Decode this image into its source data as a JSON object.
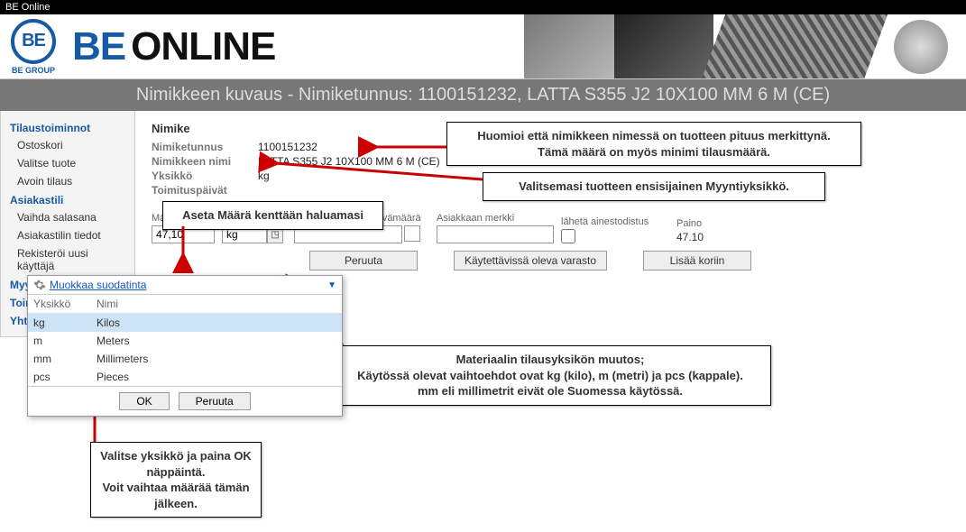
{
  "titlebar": "BE Online",
  "brand": {
    "logo_text": "BE",
    "logo_sub": "BE GROUP",
    "title1": "BE",
    "title2": "ONLINE"
  },
  "subheader": "Nimikkeen kuvaus - Nimiketunnus: 1100151232, LATTA S355 J2 10X100 MM 6 M (CE)",
  "sidebar": {
    "h1": "Tilaustoiminnot",
    "g1": [
      "Ostoskori",
      "Valitse tuote",
      "Avoin tilaus"
    ],
    "h2": "Asiakastili",
    "g2": [
      "Vaihda salasana",
      "Asiakastilin tiedot",
      "Rekisteröi uusi käyttäjä"
    ],
    "h3": "Myyntiehdot",
    "h4": "Toim",
    "h5": "Yhtey"
  },
  "item": {
    "section": "Nimike",
    "l_code": "Nimiketunnus",
    "v_code": "1100151232",
    "l_name": "Nimikkeen nimi",
    "v_name": "LATTA S355 J2 10X100 MM 6 M (CE)",
    "l_unit": "Yksikkö",
    "v_unit": "kg",
    "l_days": "Toimituspäivät"
  },
  "form": {
    "l_qty": "Määrä",
    "v_qty": "47,10",
    "l_unit": "Yksikkö",
    "v_unit": "kg",
    "l_reqdate": "Pyydetty toimituspäivämäärä",
    "v_reqdate": "",
    "l_cmark": "Asiakkaan merkki",
    "v_cmark": "",
    "l_cert": "lähetä ainestodistus",
    "l_weight": "Paino",
    "v_weight": "47.10"
  },
  "buttons": {
    "cancel": "Peruuta",
    "stock": "Käytettävissä oleva varasto",
    "add": "Lisää koriin"
  },
  "callouts": {
    "c1": "Huomioi että nimikkeen nimessä on tuotteen pituus merkittynä.\nTämä määrä on myös minimi tilausmäärä.",
    "c2": "Valitsemasi tuotteen ensisijainen Myyntiyksikkö.",
    "c3": "Aseta Määrä kenttään haluamasi",
    "c4": "Materiaalin tilausyksikön muutos;\nKäytössä olevat vaihtoehdot ovat kg (kilo), m (metri) ja pcs (kappale).\nmm eli millimetrit eivät ole Suomessa käytössä.",
    "c5": "Valitse yksikkö ja paina OK näppäintä.\nVoit vaihtaa määrää tämän jälkeen."
  },
  "dropdown": {
    "edit": "Muokkaa suodatinta",
    "col1": "Yksikkö",
    "col2": "Nimi",
    "rows": [
      {
        "u": "kg",
        "n": "Kilos"
      },
      {
        "u": "m",
        "n": "Meters"
      },
      {
        "u": "mm",
        "n": "Millimeters"
      },
      {
        "u": "pcs",
        "n": "Pieces"
      }
    ],
    "ok": "OK",
    "cancel": "Peruuta",
    "selected": 0
  }
}
